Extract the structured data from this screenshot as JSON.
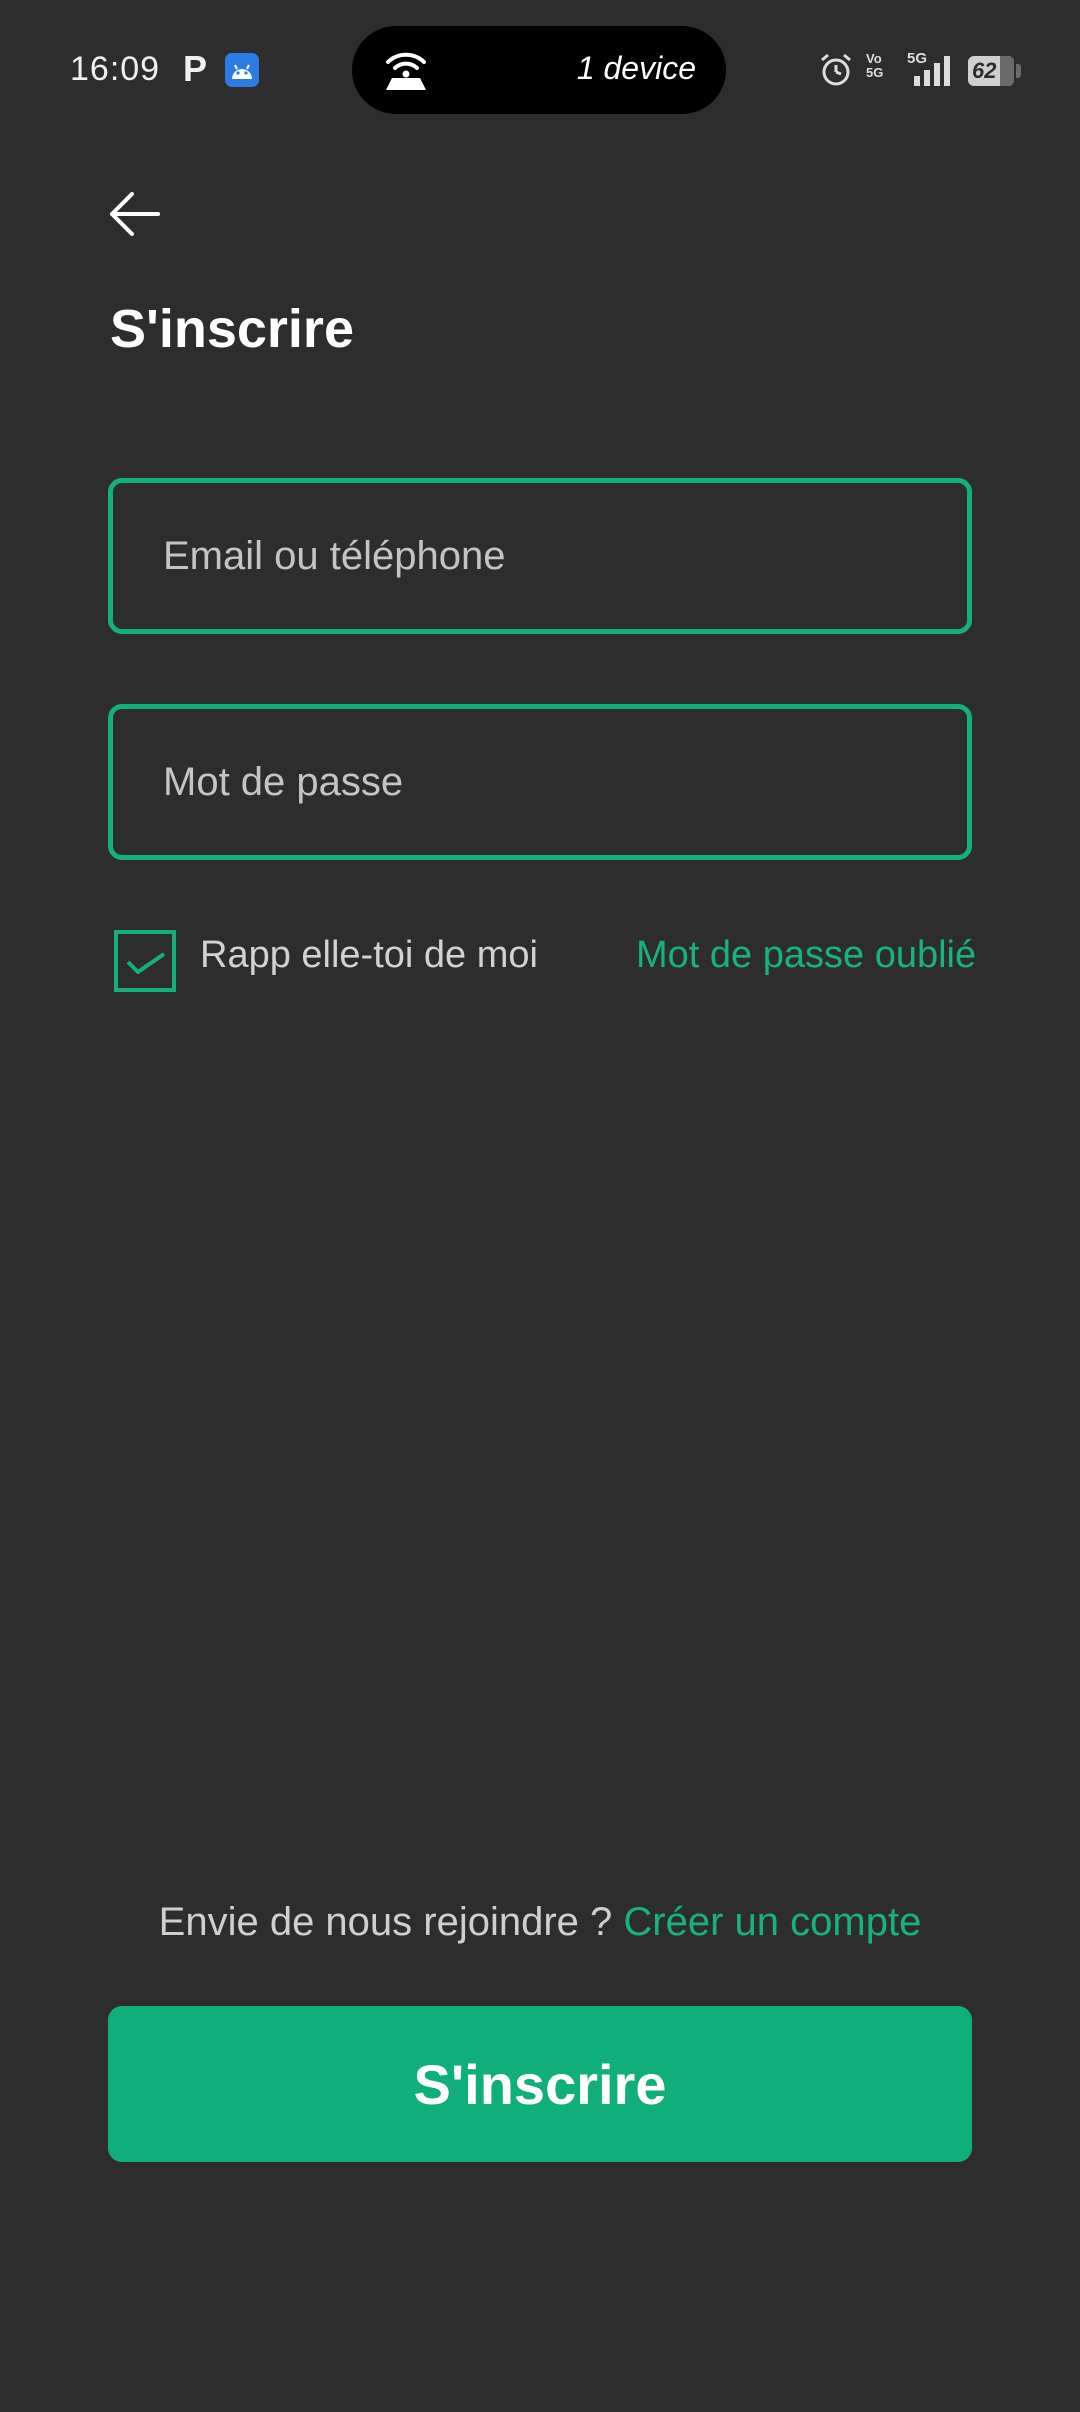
{
  "status_bar": {
    "time": "16:09",
    "p_badge": "P",
    "hotspot_label": "1 device",
    "vo_line1": "Vo",
    "vo_line2": "5G",
    "network": "5G",
    "battery": "62",
    "icons": [
      "android-app-icon",
      "hotspot-icon",
      "alarm-icon",
      "signal-icon",
      "battery-icon"
    ]
  },
  "header": {
    "back_icon": "arrow-left-icon",
    "title": "S'inscrire"
  },
  "form": {
    "email_placeholder": "Email ou téléphone",
    "email_value": "",
    "password_placeholder": "Mot de passe",
    "password_value": "",
    "remember_checked": true,
    "remember_label": "Rapp elle-toi de moi",
    "forgot_link": "Mot de passe oublié"
  },
  "footer": {
    "join_text": "Envie de nous rejoindre ?",
    "create_link": "Créer un compte",
    "submit_label": "S'inscrire"
  },
  "colors": {
    "background": "#2d2d2d",
    "accent": "#10ae7b",
    "text_primary": "#ffffff",
    "text_secondary": "#cfcfcf"
  }
}
